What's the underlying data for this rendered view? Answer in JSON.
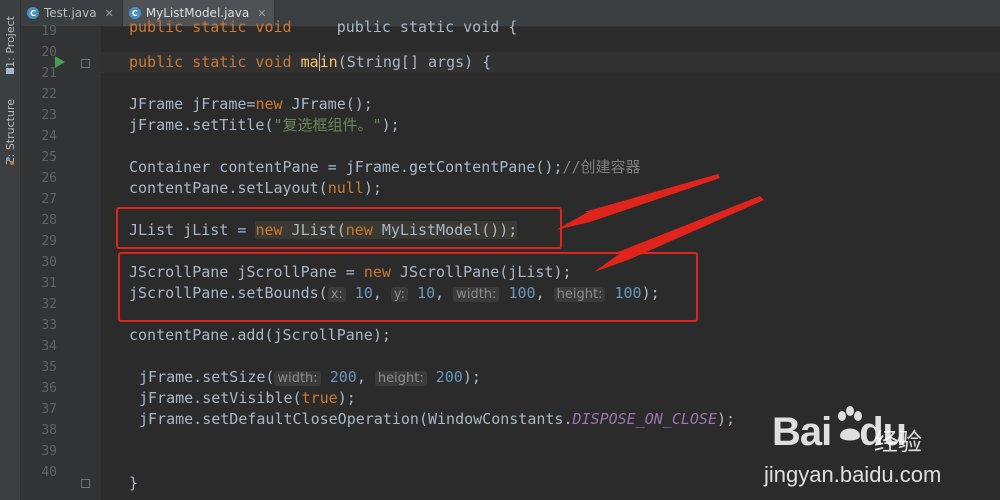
{
  "sidebar": {
    "project_tab": "1: Project",
    "structure_tab": "Z: Structure"
  },
  "tabs": [
    {
      "label": "Test.java",
      "icon": "java-class-icon"
    },
    {
      "label": "MyListModel.java",
      "icon": "java-class-icon"
    }
  ],
  "editor": {
    "line_numbers": [
      "19",
      "20",
      "21",
      "22",
      "23",
      "24",
      "25",
      "26",
      "27",
      "28",
      "29",
      "30",
      "31",
      "32",
      "33",
      "34",
      "35",
      "36",
      "37",
      "38",
      "39",
      "40"
    ],
    "lines": {
      "l19": "    public static void {",
      "l20_a": "public static void ",
      "l20_b": "ma",
      "l20_c": "in",
      "l20_d": "(String[] args) {",
      "l22_a": "JFrame jFrame=",
      "l22_b": "new",
      "l22_c": " JFrame();",
      "l23_a": "jFrame.setTitle(",
      "l23_b": "\"复选框组件。\"",
      "l23_c": ");",
      "l25_a": "Container contentPane = jFrame.getContentPane();",
      "l25_b": "//创建容器",
      "l26_a": "contentPane.setLayout(",
      "l26_b": "null",
      "l26_c": ");",
      "l28_a": "JList jList = ",
      "l28_b": "new",
      "l28_c": " JList(",
      "l28_d": "new",
      "l28_e": " MyListModel());",
      "l30_a": "JScrollPane jScrollPane = ",
      "l30_b": "new",
      "l30_c": " JScrollPane(jList);",
      "l31_a": "jScrollPane.setBounds(",
      "l31_h1": "x:",
      "l31_v1": "10",
      "l31_h2": "y:",
      "l31_v2": "10",
      "l31_h3": "width:",
      "l31_v3": "100",
      "l31_h4": "height:",
      "l31_v4": "100",
      "l31_end": ");",
      "l33": "contentPane.add(jScrollPane);",
      "l35_a": "jFrame.setSize(",
      "l35_h1": "width:",
      "l35_v1": "200",
      "l35_h2": "height:",
      "l35_v2": "200",
      "l35_end": ");",
      "l36_a": "jFrame.setVisible(",
      "l36_b": "true",
      "l36_c": ");",
      "l37_a": "jFrame.setDefaultCloseOperation(WindowConstants.",
      "l37_b": "DISPOSE_ON_CLOSE",
      "l37_c": ");",
      "l40": "}"
    }
  },
  "watermark": {
    "logo": "Bai",
    "logo_suffix": "du",
    "cn": "经验",
    "url": "jingyan.baidu.com"
  },
  "colors": {
    "editor_bg": "#2b2b2b",
    "keyword": "#cc7832",
    "string": "#6a8759",
    "number": "#6897bb",
    "annotation_red": "#e0241c"
  }
}
